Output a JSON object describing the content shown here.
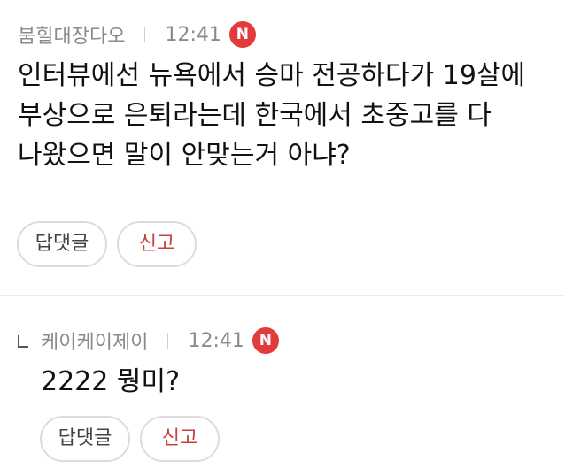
{
  "comments": [
    {
      "author": "붐힐대장다오",
      "time": "12:41",
      "badge": "N",
      "text": "인터뷰에선 뉴욕에서 승마 전공하다가 19살에 부상으로 은퇴라는데 한국에서 초중고를 다 나왔으면 말이 안맞는거 아냐?",
      "reply_label": "답댓글",
      "report_label": "신고"
    },
    {
      "author": "케이케이제이",
      "time": "12:41",
      "badge": "N",
      "text": "2222 뭥미?",
      "reply_label": "답댓글",
      "report_label": "신고"
    }
  ],
  "colors": {
    "badge": "#e33b3b",
    "report": "#c8423a",
    "meta": "#8a8a8a",
    "text": "#111111"
  }
}
